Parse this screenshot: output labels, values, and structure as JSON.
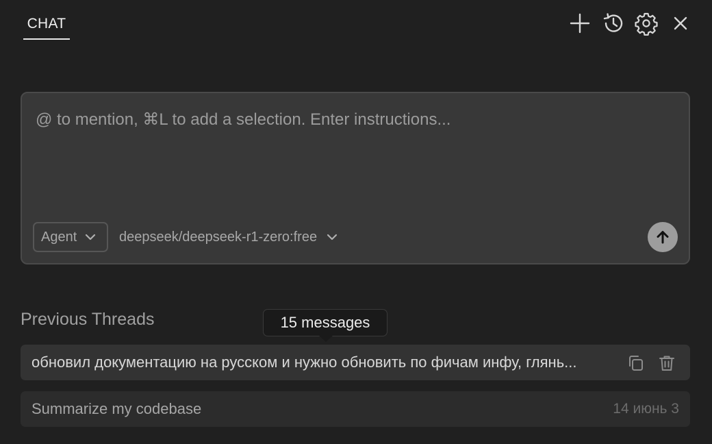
{
  "header": {
    "tab_label": "CHAT",
    "icons": [
      "plus-icon",
      "history-icon",
      "gear-icon",
      "close-icon"
    ]
  },
  "composer": {
    "placeholder": "@ to mention, ⌘L to add a selection. Enter instructions...",
    "mode_label": "Agent",
    "model_label": "deepseek/deepseek-r1-zero:free",
    "send_icon": "arrow-up-icon"
  },
  "threads": {
    "title": "Previous Threads",
    "tooltip": "15 messages",
    "items": [
      {
        "title": "обновил документацию на русском и нужно обновить по фичам инфу, глянь...",
        "actions": [
          "copy-icon",
          "trash-icon"
        ]
      },
      {
        "title": "Summarize my codebase",
        "date": "14 июнь 3"
      }
    ]
  },
  "colors": {
    "background": "#202020",
    "composer_bg": "#383838",
    "send_button": "#9d9d9d",
    "row_bg": "#2c2c2c"
  }
}
